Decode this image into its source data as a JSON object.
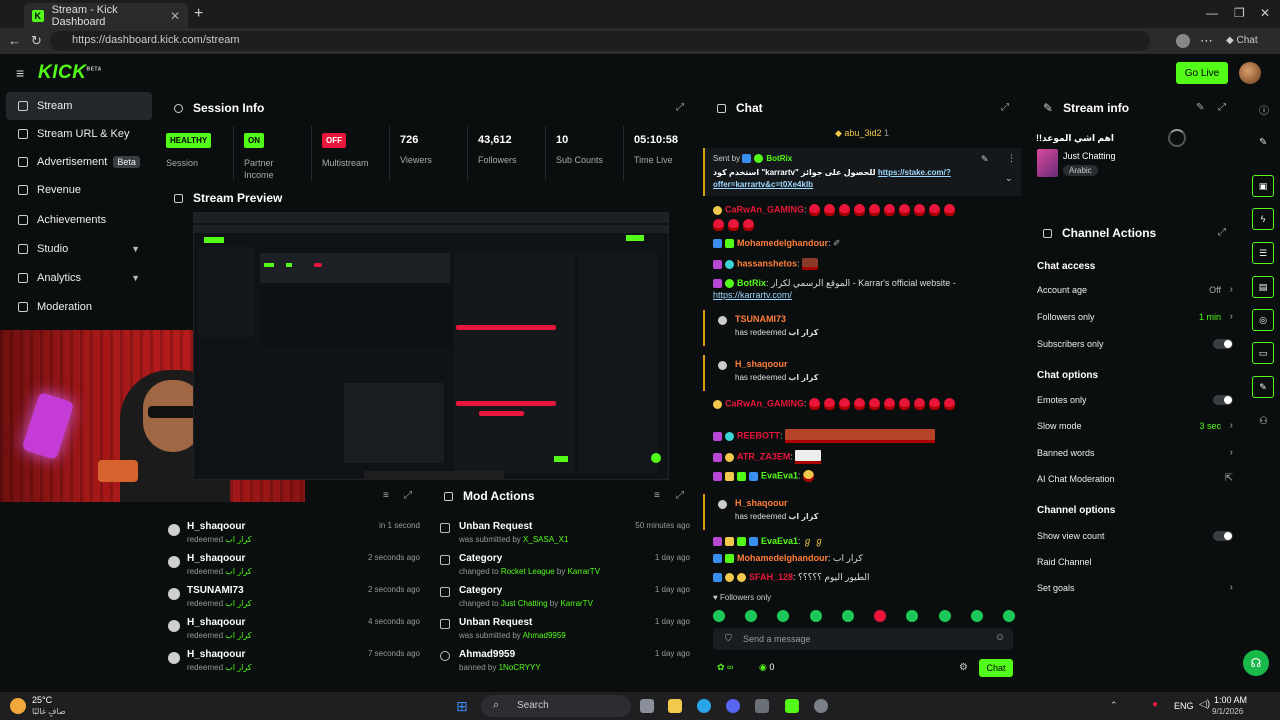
{
  "browser": {
    "tab_title": "Stream - Kick Dashboard",
    "url": "https://dashboard.kick.com/stream",
    "chat_button": "Chat"
  },
  "header": {
    "logo": "KICK",
    "logo_badge": "BETA",
    "go_live": "Go Live"
  },
  "sidebar": {
    "items": [
      {
        "label": "Stream",
        "icon": "stream-icon"
      },
      {
        "label": "Stream URL & Key",
        "icon": "key-icon"
      },
      {
        "label": "Advertisement",
        "icon": "ad-icon",
        "badge": "Beta"
      },
      {
        "label": "Revenue",
        "icon": "revenue-icon"
      },
      {
        "label": "Achievements",
        "icon": "trophy-icon"
      },
      {
        "label": "Studio",
        "icon": "studio-icon"
      },
      {
        "label": "Analytics",
        "icon": "analytics-icon"
      },
      {
        "label": "Moderation",
        "icon": "moderation-icon"
      }
    ]
  },
  "session": {
    "title": "Session Info",
    "stats": [
      {
        "badge": "HEALTHY",
        "label": "Session"
      },
      {
        "badge": "ON",
        "label": "Partner Income"
      },
      {
        "badge": "OFF",
        "label": "Multistream"
      },
      {
        "value": "726",
        "label": "Viewers"
      },
      {
        "value": "43,612",
        "label": "Followers"
      },
      {
        "value": "10",
        "label": "Sub Counts"
      },
      {
        "value": "05:10:58",
        "label": "Time Live"
      }
    ]
  },
  "preview": {
    "title": "Stream Preview"
  },
  "activity": {
    "rows": [
      {
        "name": "H_shaqoour",
        "action": "redeemed",
        "reward": "كرار اب",
        "time": "in 1 second"
      },
      {
        "name": "H_shaqoour",
        "action": "redeemed",
        "reward": "كرار اب",
        "time": "2 seconds ago"
      },
      {
        "name": "TSUNAMI73",
        "action": "redeemed",
        "reward": "كرار اب",
        "time": "2 seconds ago"
      },
      {
        "name": "H_shaqoour",
        "action": "redeemed",
        "reward": "كرار اب",
        "time": "4 seconds ago"
      },
      {
        "name": "H_shaqoour",
        "action": "redeemed",
        "reward": "كرار اب",
        "time": "7 seconds ago"
      }
    ]
  },
  "mod_actions": {
    "title": "Mod Actions",
    "rows": [
      {
        "title": "Unban Request",
        "pre": "was submitted by",
        "who": "X_SASA_X1",
        "post": "",
        "by": "",
        "time": "50 minutes ago"
      },
      {
        "title": "Category",
        "pre": "changed to",
        "who": "Rocket League",
        "post": "by",
        "by": "KarrarTV",
        "time": "1 day ago"
      },
      {
        "title": "Category",
        "pre": "changed to",
        "who": "Just Chatting",
        "post": "by",
        "by": "KarrarTV",
        "time": "1 day ago"
      },
      {
        "title": "Unban Request",
        "pre": "was submitted by",
        "who": "Ahmad9959",
        "post": "",
        "by": "",
        "time": "1 day ago"
      },
      {
        "title": "Ahmad9959",
        "pre": "banned by",
        "who": "1NoCRYYY",
        "post": "",
        "by": "",
        "time": "1 day ago"
      }
    ]
  },
  "chat": {
    "title": "Chat",
    "pinned_user": "abu_3id2",
    "pinned_count": "1",
    "pinned_sent_by": "Sent by",
    "pinned_bot": "BotRix",
    "pinned_text": "استخدم كود \"karrartv\" للحصول على جوائز",
    "pinned_link": "https://stake.com/?offer=karrartv&c=t0Xe4klb",
    "messages": [
      {
        "user": "CaRwAn_GAMING",
        "color": "#e8163a",
        "text": "",
        "emotes": 12
      },
      {
        "user": "Mohamedelghandour",
        "color": "#ff7d3a",
        "text": "",
        "emotes": 0
      },
      {
        "user": "hassanshetos",
        "color": "#ff7d3a",
        "text": "",
        "emotes": 0
      },
      {
        "user": "BotRix",
        "color": "#53fc18",
        "text": "الموقع الرسمي لكرار - Karrar's official website -",
        "link": "https://karrartv.com/"
      }
    ],
    "redeems": [
      {
        "user": "TSUNAMI73",
        "text": "has redeemed",
        "reward": "كرار اب"
      },
      {
        "user": "H_shaqoour",
        "text": "has redeemed",
        "reward": "كرار اب"
      },
      {
        "user": "H_shaqoour",
        "text": "has redeemed",
        "reward": "كرار اب"
      }
    ],
    "messages2": [
      {
        "user": "CaRwAn_GAMING",
        "color": "#e8163a"
      },
      {
        "user": "REEBOTT",
        "color": "#e8163a"
      },
      {
        "user": "ATR_ZA3EM",
        "color": "#e8163a"
      },
      {
        "user": "EvaEva1",
        "color": "#53fc18"
      }
    ],
    "messages3": [
      {
        "user": "EvaEva1",
        "color": "#53fc18",
        "text": ""
      },
      {
        "user": "Mohamedelghandour",
        "color": "#ff7d3a",
        "text": "كرار اب"
      },
      {
        "user": "SFAH_128",
        "color": "#e8163a",
        "text": "الطيور اليوم ؟؟؟؟؟"
      }
    ],
    "followers_only": "Followers only",
    "input_placeholder": "Send a message",
    "send_label": "Chat",
    "viewer_count": "0"
  },
  "stream_info": {
    "title": "Stream info",
    "stream_title": "!!اهم اشي الموعد",
    "category": "Just Chatting",
    "tag": "Arabic"
  },
  "channel_actions": {
    "title": "Channel Actions",
    "chat_access": "Chat access",
    "account_age": "Account age",
    "account_age_val": "Off",
    "followers_only": "Followers only",
    "followers_only_val": "1 min",
    "subscribers_only": "Subscribers only",
    "chat_options": "Chat options",
    "emotes_only": "Emotes only",
    "slow_mode": "Slow mode",
    "slow_mode_val": "3 sec",
    "banned_words": "Banned words",
    "ai_moderation": "AI Chat Moderation",
    "channel_options": "Channel options",
    "show_view_count": "Show view count",
    "raid_channel": "Raid Channel",
    "set_goals": "Set goals"
  },
  "taskbar": {
    "weather_temp": "25°C",
    "weather_desc": "صافٍ غالبًا",
    "search": "Search",
    "lang": "ENG",
    "time": "1:00 AM",
    "date": "9/1/2026"
  },
  "colors": {
    "accent": "#53fc18",
    "bg": "#0b0e0f",
    "danger": "#e8163a"
  }
}
